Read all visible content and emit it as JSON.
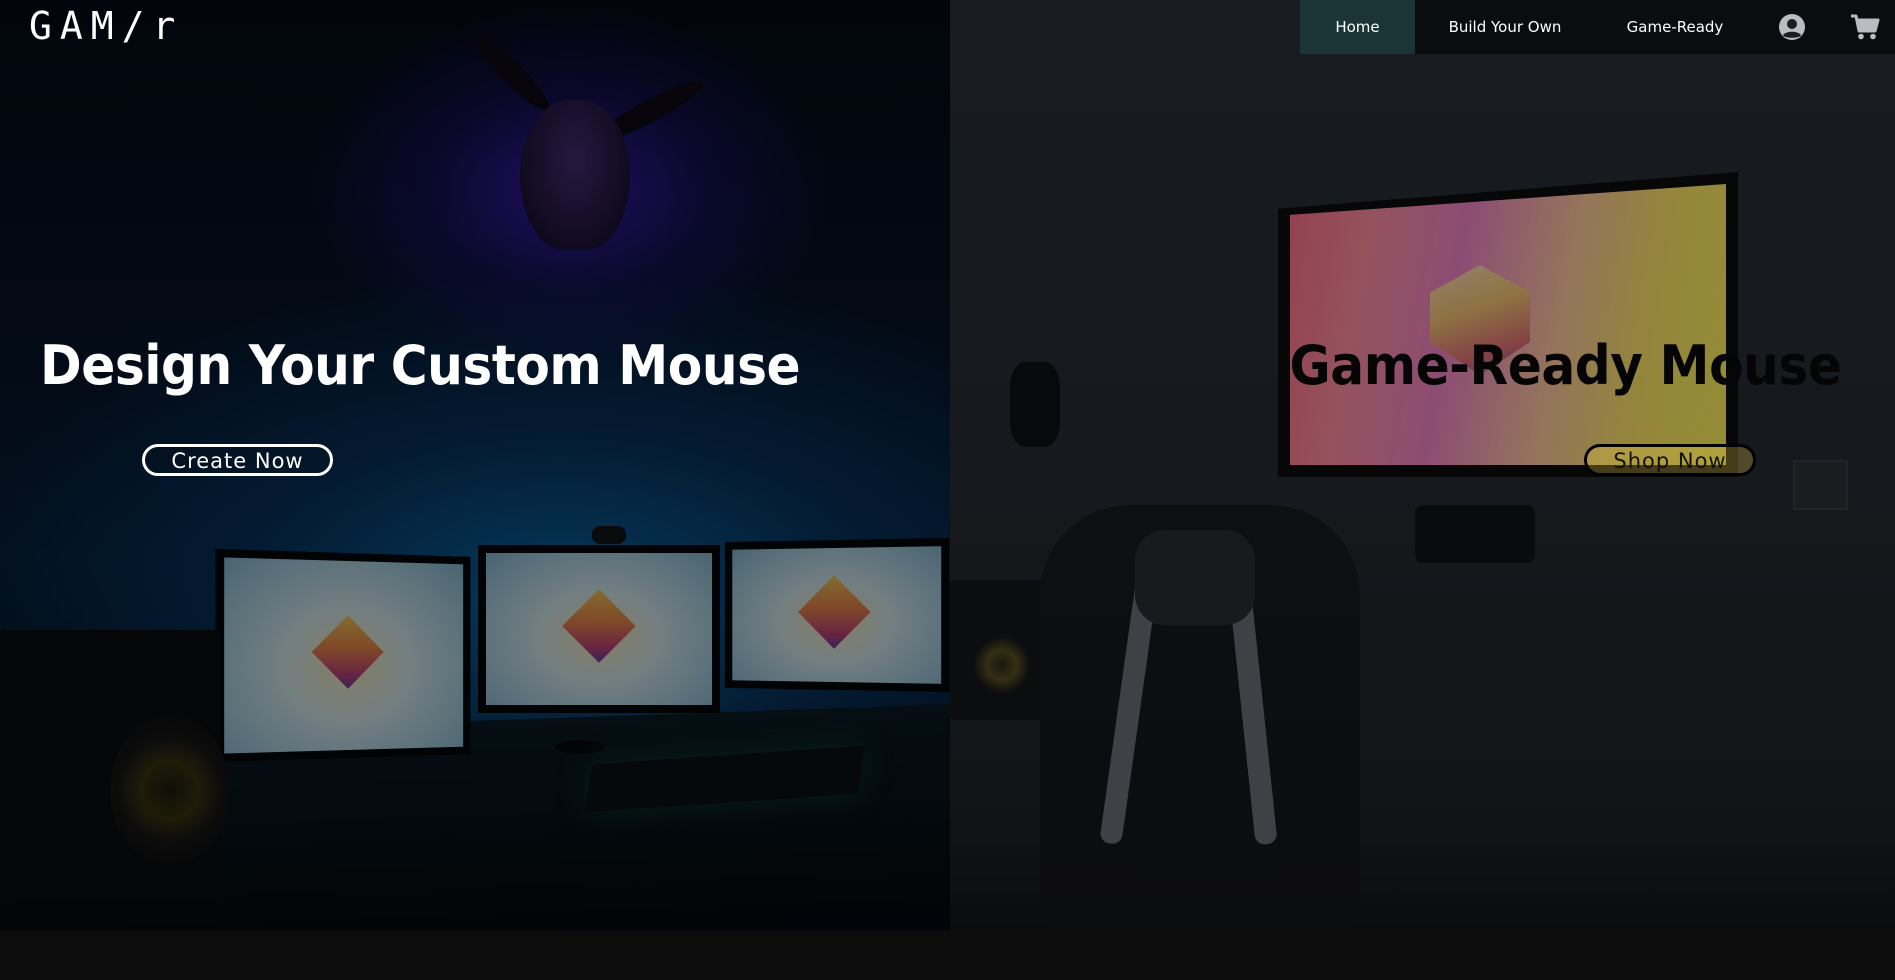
{
  "brand": {
    "name": "GAM/r"
  },
  "nav": {
    "items": [
      {
        "label": "Home",
        "active": true
      },
      {
        "label": "Build Your Own",
        "active": false
      },
      {
        "label": "Game-Ready",
        "active": false
      }
    ],
    "icons": [
      "user-account-icon",
      "shopping-cart-icon"
    ]
  },
  "hero": {
    "left": {
      "title": "Design Your Custom Mouse",
      "button": "Create Now"
    },
    "right": {
      "title": "Game-Ready Mouse",
      "button": "Shop Now"
    }
  },
  "colors": {
    "nav_active_bg": "#1b3536",
    "left_title": "#ffffff",
    "right_title": "#050505"
  }
}
